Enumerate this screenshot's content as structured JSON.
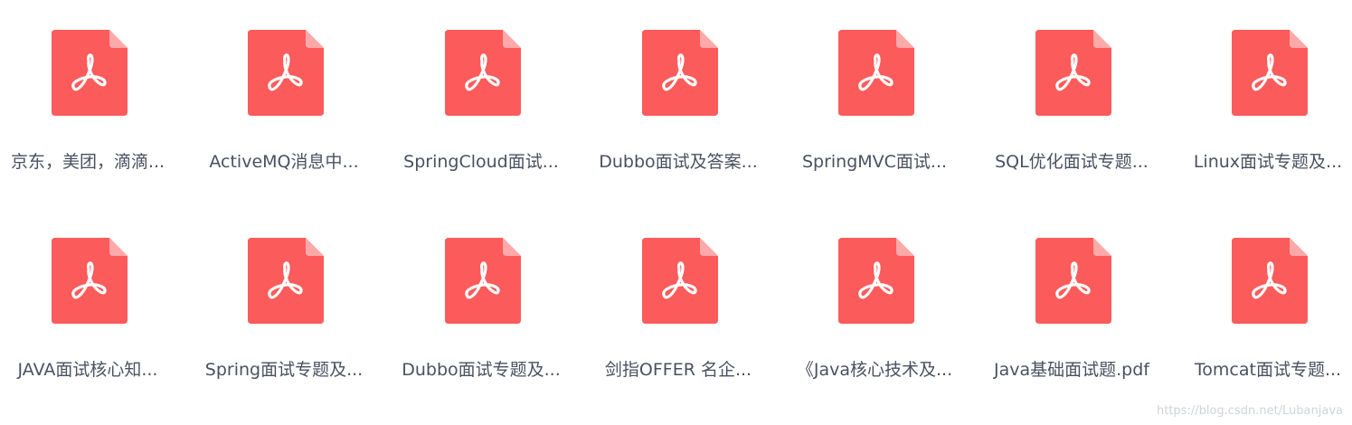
{
  "files": [
    {
      "name": "京东，美团，滴滴...",
      "type": "pdf-file-icon"
    },
    {
      "name": "ActiveMQ消息中...",
      "type": "pdf-file-icon"
    },
    {
      "name": "SpringCloud面试...",
      "type": "pdf-file-icon"
    },
    {
      "name": "Dubbo面试及答案...",
      "type": "pdf-file-icon"
    },
    {
      "name": "SpringMVC面试...",
      "type": "pdf-file-icon"
    },
    {
      "name": "SQL优化面试专题...",
      "type": "pdf-file-icon"
    },
    {
      "name": "Linux面试专题及...",
      "type": "pdf-file-icon"
    },
    {
      "name": "JAVA面试核心知...",
      "type": "pdf-file-icon"
    },
    {
      "name": "Spring面试专题及...",
      "type": "pdf-file-icon"
    },
    {
      "name": "Dubbo面试专题及...",
      "type": "pdf-file-icon"
    },
    {
      "name": "剑指OFFER 名企...",
      "type": "pdf-file-icon"
    },
    {
      "name": "《Java核心技术及...",
      "type": "pdf-file-icon"
    },
    {
      "name": "Java基础面试题.pdf",
      "type": "pdf-file-icon"
    },
    {
      "name": "Tomcat面试专题...",
      "type": "pdf-file-icon"
    }
  ],
  "watermark": "https://blog.csdn.net/Lubanjava",
  "colors": {
    "icon_body": "#fb5b5a",
    "icon_fold": "#fcaaa9",
    "icon_glyph": "#ffffff",
    "label": "#4a5160"
  }
}
